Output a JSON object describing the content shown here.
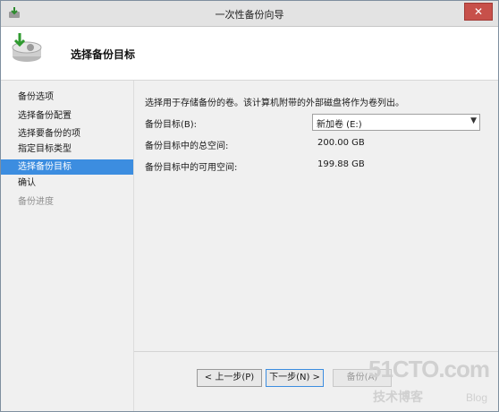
{
  "window": {
    "title": "一次性备份向导",
    "close_glyph": "✕"
  },
  "header": {
    "title": "选择备份目标",
    "icon": "backup-drive-icon"
  },
  "nav": {
    "items": [
      {
        "label": "备份选项"
      },
      {
        "label": "选择备份配置"
      },
      {
        "label": "选择要备份的项"
      },
      {
        "label": "指定目标类型"
      },
      {
        "label": "选择备份目标"
      },
      {
        "label": "确认"
      },
      {
        "label": "备份进度"
      }
    ],
    "active_index": 4
  },
  "content": {
    "description": "选择用于存储备份的卷。该计算机附带的外部磁盘将作为卷列出。",
    "target_label": "备份目标(B):",
    "target_value": "新加卷 (E:)",
    "total_space_label": "备份目标中的总空间:",
    "total_space_value": "200.00 GB",
    "free_space_label": "备份目标中的可用空间:",
    "free_space_value": "199.88 GB"
  },
  "buttons": {
    "prev": "< 上一步(P)",
    "next": "下一步(N) >",
    "backup": "备份(A)"
  },
  "watermark": {
    "site": "51CTO.com",
    "tagline": "技术博客",
    "blog": "Blog"
  },
  "colors": {
    "accent": "#3c8de0",
    "close": "#c7504a"
  }
}
